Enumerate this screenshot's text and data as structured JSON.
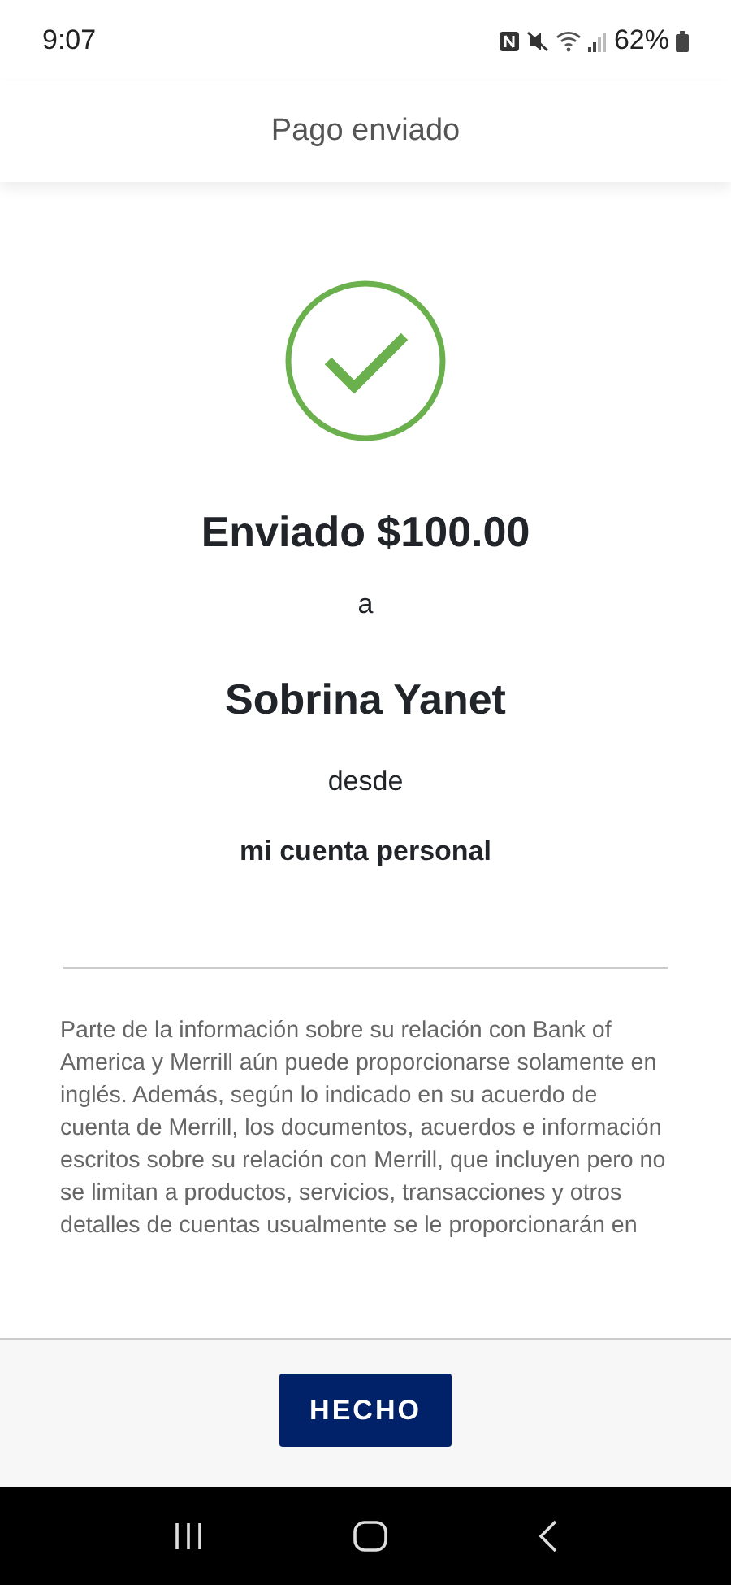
{
  "status_bar": {
    "time": "9:07",
    "battery": "62%"
  },
  "header": {
    "title": "Pago enviado"
  },
  "confirmation": {
    "amount_line": "Enviado $100.00",
    "to_word": "a",
    "recipient": "Sobrina Yanet",
    "from_word": "desde",
    "account": "mi cuenta personal"
  },
  "disclaimer": "Parte de la información sobre su relación con Bank of America y Merrill aún puede proporcionarse solamente en inglés. Además, según lo indicado en su acuerdo de cuenta de Merrill, los documentos, acuerdos e información escritos sobre su relación con Merrill, que incluyen pero no se limitan a productos, servicios, transacciones y otros detalles de cuentas usualmente se le proporcionarán en",
  "footer": {
    "button": "HECHO"
  }
}
